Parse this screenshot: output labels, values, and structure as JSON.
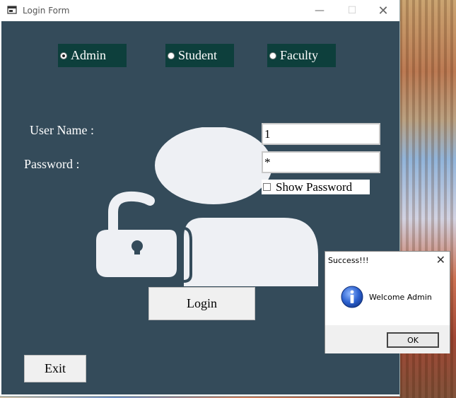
{
  "window": {
    "title": "Login Form",
    "minimize_glyph": "—",
    "maximize_glyph": "☐",
    "close_glyph": "✕"
  },
  "roles": [
    {
      "label": "Admin",
      "checked": true
    },
    {
      "label": "Student",
      "checked": false
    },
    {
      "label": "Faculty",
      "checked": false
    }
  ],
  "form": {
    "username_label": "User Name :",
    "password_label": "Password :",
    "username_value": "1",
    "password_value": "*",
    "show_password_label": "Show Password",
    "login_label": "Login",
    "exit_label": "Exit"
  },
  "message_box": {
    "title": "Success!!!",
    "close_glyph": "✕",
    "message": "Welcome Admin",
    "ok_label": "OK",
    "icon": "info-icon"
  },
  "colors": {
    "client_bg": "#344b5a",
    "radio_bg": "#0d3f3c",
    "graphic": "#eef0f4"
  }
}
